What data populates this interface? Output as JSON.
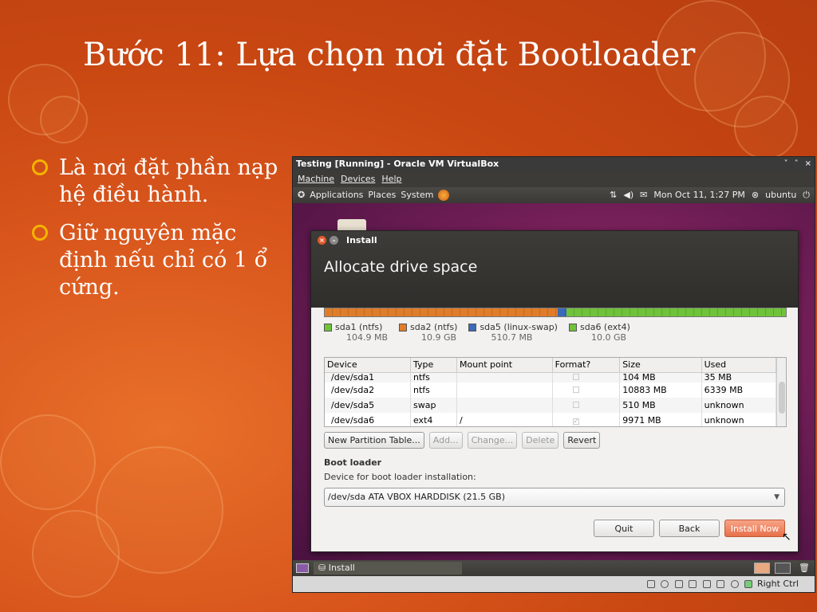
{
  "slide": {
    "title": "Bước 11: Lựa chọn nơi đặt Bootloader",
    "bullets": [
      "Là nơi đặt phần nạp hệ điều hành.",
      "Giữ nguyên mặc định nếu chỉ có 1 ổ cứng."
    ]
  },
  "vm": {
    "title": "Testing [Running] - Oracle VM VirtualBox",
    "menu": [
      "Machine",
      "Devices",
      "Help"
    ],
    "controls": [
      "˅",
      "˄",
      "×"
    ]
  },
  "gnome": {
    "menus": [
      "Applications",
      "Places",
      "System"
    ],
    "datetime": "Mon Oct 11,  1:27 PM",
    "user": "ubuntu"
  },
  "dialog": {
    "window_title": "Install",
    "heading": "Allocate drive space",
    "partitions_bar": [
      {
        "fraction": 0.505,
        "color": "#e07d2a"
      },
      {
        "fraction": 0.02,
        "color": "#3b6ab8"
      },
      {
        "fraction": 0.475,
        "color": "#6fc23a"
      }
    ],
    "legend": [
      {
        "name": "sda1 (ntfs)",
        "size": "104.9 MB",
        "color": "#6fc23a"
      },
      {
        "name": "sda2 (ntfs)",
        "size": "10.9 GB",
        "color": "#e07d2a"
      },
      {
        "name": "sda5 (linux-swap)",
        "size": "510.7 MB",
        "color": "#3b6ab8"
      },
      {
        "name": "sda6 (ext4)",
        "size": "10.0 GB",
        "color": "#6fc23a"
      }
    ],
    "table": {
      "headers": [
        "Device",
        "Type",
        "Mount point",
        "Format?",
        "Size",
        "Used"
      ],
      "rows": [
        [
          "/dev/sda1",
          "ntfs",
          "",
          "",
          "104 MB",
          "35 MB"
        ],
        [
          "/dev/sda2",
          "ntfs",
          "",
          "",
          "10883 MB",
          "6339 MB"
        ],
        [
          "/dev/sda5",
          "swap",
          "",
          "",
          "510 MB",
          "unknown"
        ],
        [
          "/dev/sda6",
          "ext4",
          "/",
          "",
          "9971 MB",
          "unknown"
        ]
      ]
    },
    "buttons": {
      "new_table": "New Partition Table...",
      "add": "Add...",
      "change": "Change...",
      "delete": "Delete",
      "revert": "Revert"
    },
    "boot_loader": {
      "label": "Boot loader",
      "sub": "Device for boot loader installation:",
      "selected": "/dev/sda ATA VBOX HARDDISK (21.5 GB)"
    },
    "actions": {
      "quit": "Quit",
      "back": "Back",
      "install": "Install Now"
    }
  },
  "taskbar": {
    "item": "Install"
  },
  "statusbar": {
    "host_key": "Right Ctrl"
  }
}
